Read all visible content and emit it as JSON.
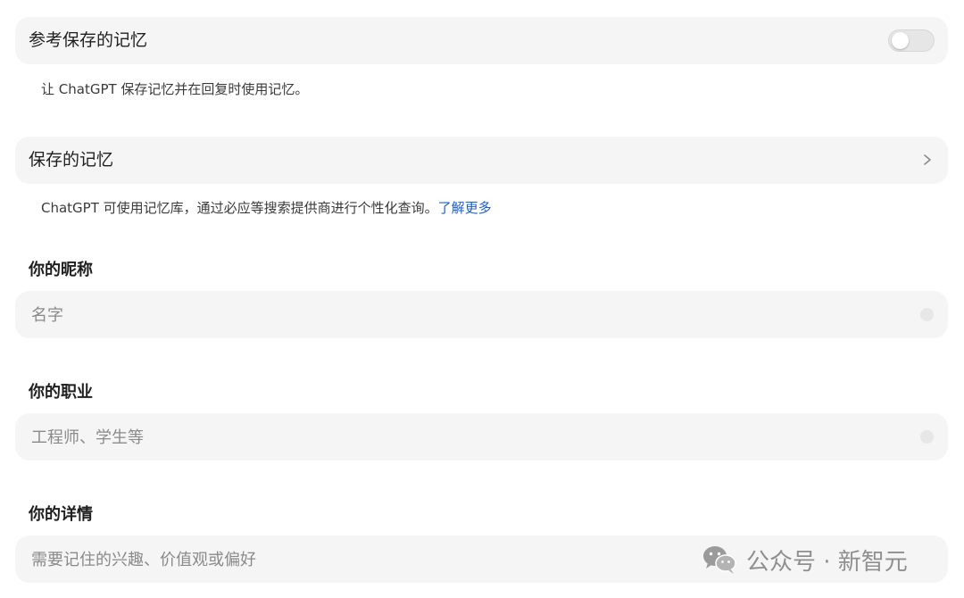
{
  "memory_toggle": {
    "title": "参考保存的记忆",
    "enabled": false,
    "helper": "让 ChatGPT 保存记忆并在回复时使用记忆。"
  },
  "saved_memories": {
    "title": "保存的记忆",
    "helper_text": "ChatGPT 可使用记忆库，通过必应等搜索提供商进行个性化查询。",
    "learn_more": "了解更多",
    "link_color": "#1a5fd1"
  },
  "nickname": {
    "label": "你的昵称",
    "placeholder": "名字",
    "value": ""
  },
  "occupation": {
    "label": "你的职业",
    "placeholder": "工程师、学生等",
    "value": ""
  },
  "details": {
    "label": "你的详情",
    "placeholder": "需要记住的兴趣、价值观或偏好",
    "value": ""
  },
  "watermark": {
    "text": "公众号 · 新智元",
    "icon": "wechat-icon"
  }
}
